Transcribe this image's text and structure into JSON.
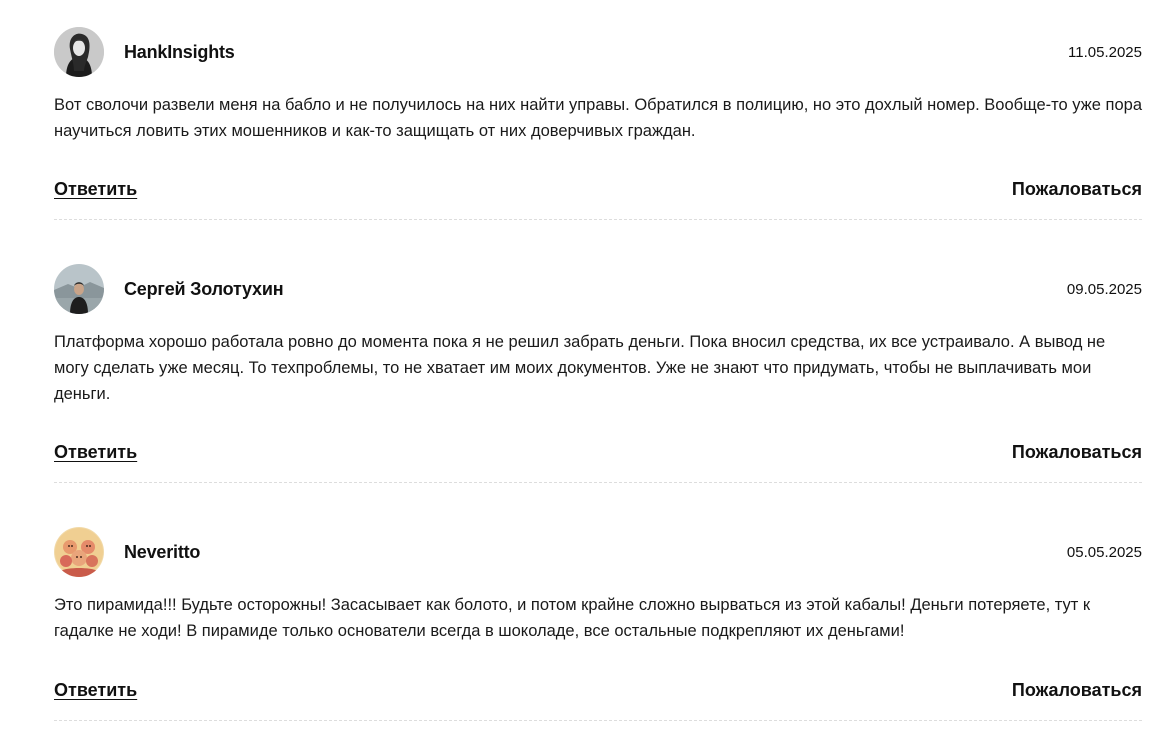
{
  "comments": [
    {
      "author": "HankInsights",
      "date": "11.05.2025",
      "text": "Вот сволочи развели меня на бабло и не получилось на них найти управы. Обратился в полицию, но это дохлый номер. Вообще-то уже пора научиться ловить этих мошенников и как-то защищать от них доверчивых граждан.",
      "reply_label": "Ответить",
      "report_label": "Пожаловаться"
    },
    {
      "author": "Сергей Золотухин",
      "date": "09.05.2025",
      "text": "Платформа хорошо работала ровно до момента пока я не решил забрать деньги. Пока вносил средства, их все устраивало. А вывод не могу сделать уже месяц. То техпроблемы, то не хватает им моих документов. Уже не знают что придумать, чтобы не выплачивать мои деньги.",
      "reply_label": "Ответить",
      "report_label": "Пожаловаться"
    },
    {
      "author": "Neveritto",
      "date": "05.05.2025",
      "text": "Это пирамида!!! Будьте осторожны! Засасывает как болото, и потом крайне сложно вырваться из этой кабалы! Деньги потеряете, тут к гадалке не ходи! В пирамиде только основатели всегда в шоколаде, все остальные подкрепляют их деньгами!",
      "reply_label": "Ответить",
      "report_label": "Пожаловаться"
    }
  ]
}
